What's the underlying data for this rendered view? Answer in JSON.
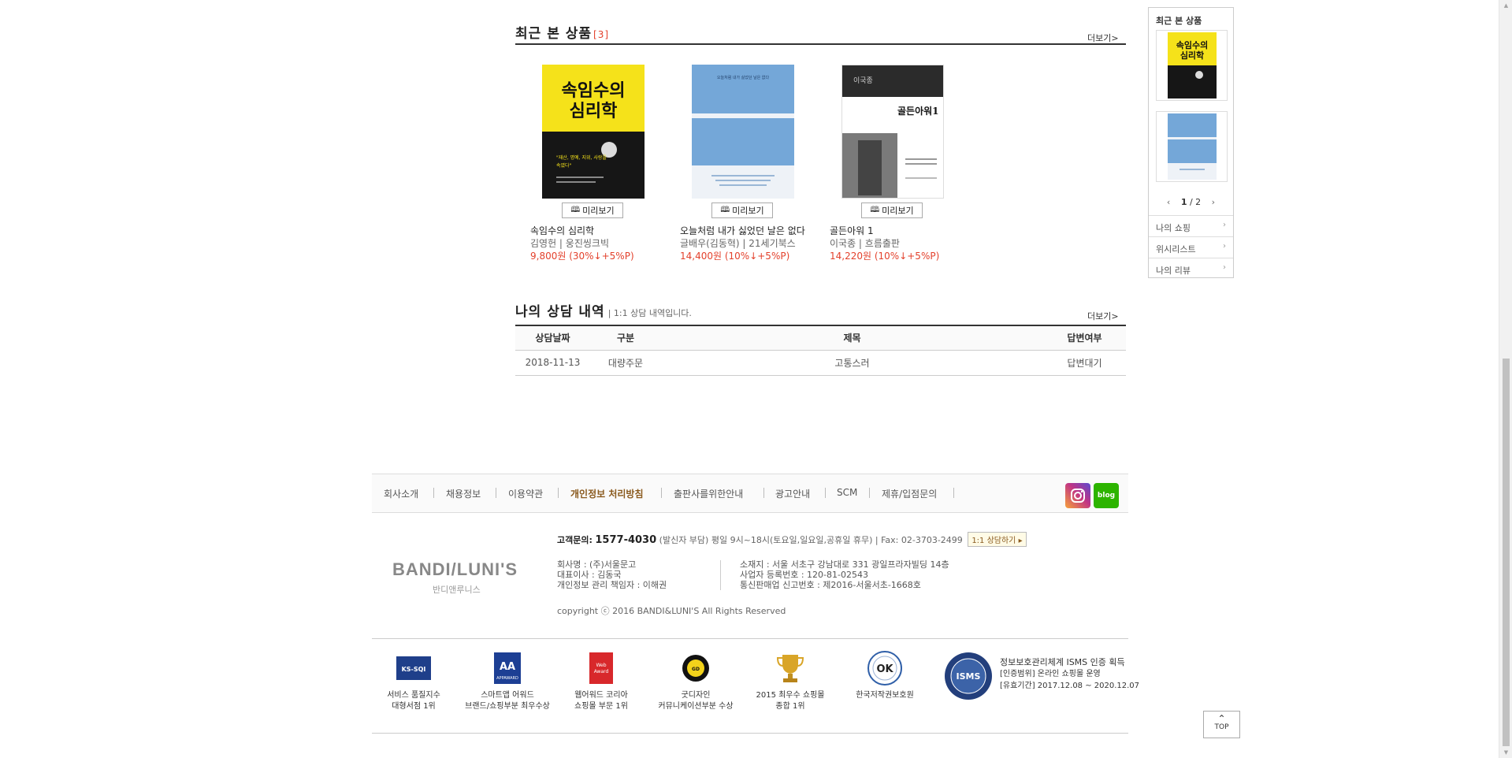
{
  "recent": {
    "title": "최근 본 상품",
    "count": "[3]",
    "more": "더보기>",
    "preview_label": "미리보기",
    "items": [
      {
        "title": "속임수의 심리학",
        "author": "김영헌 | 웅진씽크빅",
        "price": "9,800원 (30%↓+5%P)",
        "cover_text": "속임수의 심리학",
        "cover_quote": "\"재산, 명예, 지위, 사랑을 속였다\""
      },
      {
        "title": "오늘처럼 내가 싫었던 날은 없다",
        "author": "글배우(김동혁) | 21세기북스",
        "price": "14,400원 (10%↓+5%P)",
        "cover_text": "오늘처럼 내가 싫었던 날은 없다"
      },
      {
        "title": "골든아워 1",
        "author": "이국종 | 흐름출판",
        "price": "14,220원 (10%↓+5%P)",
        "cover_text": "골든아워1",
        "cover_author": "이국종"
      }
    ]
  },
  "consult": {
    "title": "나의 상담 내역",
    "subtitle": "| 1:1 상담 내역입니다.",
    "more": "더보기>",
    "headers": [
      "상담날짜",
      "구분",
      "제목",
      "답변여부"
    ],
    "rows": [
      {
        "date": "2018-11-13",
        "category": "대량주문",
        "subject": "고통스러",
        "status": "답변대기"
      }
    ]
  },
  "sidebar": {
    "title": "최근 본 상품",
    "pager_current": "1",
    "pager_total": "/ 2",
    "menu": [
      "나의 쇼핑",
      "위시리스트",
      "나의 리뷰"
    ]
  },
  "footer": {
    "nav": [
      "회사소개",
      "채용정보",
      "이용약관",
      "개인정보 처리방침",
      "출판사를위한안내",
      "광고안내",
      "SCM",
      "제휴/입점문의"
    ],
    "sns": [
      "instagram",
      "blog"
    ],
    "cs_label": "고객문의:",
    "cs_phone": "1577-4030",
    "cs_hours": "(발신자 부담) 평일 9시~18시(토요일,일요일,공휴일 휴무) | Fax: 02-3703-2499",
    "cs_button": "1:1 상담하기",
    "logo": "BANDI/LUNI'S",
    "logo_sub": "반디앤루니스",
    "info_left": [
      "회사명 : (주)서울문고",
      "대표이사 : 김동국",
      "개인정보 관리 책임자 : 이해권"
    ],
    "info_right": [
      "소재지 : 서울 서초구 강남대로 331 광일프라자빌딩 14층",
      "사업자 등록번호 : 120-81-02543",
      "통신판매업 신고번호 : 제2016-서울서초-1668호"
    ],
    "copyright": "copyright ⓒ 2016 BANDI&LUNI'S All Rights Reserved",
    "awards": [
      {
        "line1": "서비스 품질지수",
        "line2": "대형서점 1위",
        "badge": "KS-SQI"
      },
      {
        "line1": "스마트앱 어워드",
        "line2": "브랜드/쇼핑부분 최우수상",
        "badge": "AA"
      },
      {
        "line1": "웹어워드 코리아",
        "line2": "쇼핑몰 부문 1위",
        "badge": "Web Award"
      },
      {
        "line1": "굿디자인",
        "line2": "커뮤니케이션부분 수상",
        "badge": "GOOD DESIGN"
      },
      {
        "line1": "2015 최우수 쇼핑몰",
        "line2": "종합 1위",
        "badge": "trophy"
      },
      {
        "line1": "한국저작권보호원",
        "line2": "",
        "badge": "OK"
      }
    ],
    "isms": {
      "badge": "ISMS",
      "line1": "정보보호관리체계 ISMS 인증 획득",
      "line2": "[인증범위] 온라인 쇼핑몰 운영",
      "line3": "[유효기간] 2017.12.08 ~ 2020.12.07"
    },
    "top": "TOP"
  },
  "colors": {
    "accent_red": "#e3412c",
    "instagram": "#c13584",
    "blog": "#2db400"
  }
}
